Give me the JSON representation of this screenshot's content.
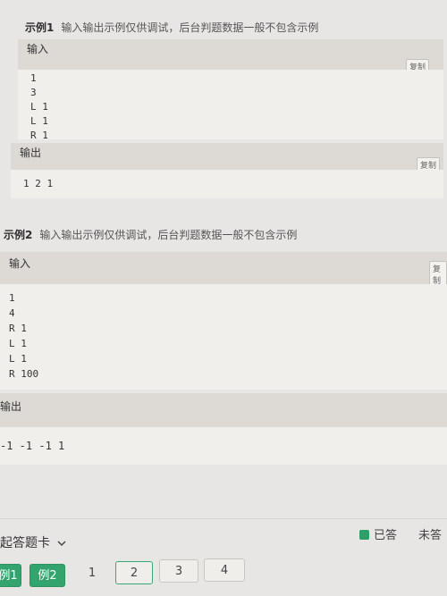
{
  "example1": {
    "title": "示例1",
    "note": "输入输出示例仅供调试，后台判题数据一般不包含示例",
    "input_label": "输入",
    "input_lines": [
      "1",
      "3",
      "L 1",
      "L 1",
      "R 1"
    ],
    "output_label": "输出",
    "output_lines": [
      "1 2 1"
    ],
    "copy_label": "复制"
  },
  "example2": {
    "title": "示例2",
    "note": "输入输出示例仅供调试，后台判题数据一般不包含示例",
    "input_label": "输入",
    "input_lines": [
      "1",
      "4",
      "R 1",
      "L 1",
      "L 1",
      "R 100"
    ],
    "output_label": "输出",
    "output_lines": [
      "-1 -1 -1 1"
    ],
    "copy_label": "复制"
  },
  "answer_card": {
    "toggle_label": "起答题卡",
    "legend_answered": "已答",
    "legend_unanswered": "未答",
    "answered_color": "#2f9e68",
    "questions": [
      {
        "label": "例1",
        "state": "answered"
      },
      {
        "label": "例2",
        "state": "answered"
      },
      {
        "label": "1",
        "state": "unanswered"
      },
      {
        "label": "2",
        "state": "current"
      },
      {
        "label": "3",
        "state": "unanswered"
      },
      {
        "label": "4",
        "state": "unanswered"
      }
    ]
  }
}
